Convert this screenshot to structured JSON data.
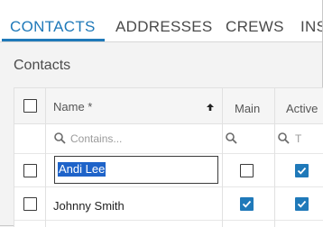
{
  "tabs": [
    {
      "label": "CONTACTS",
      "active": true
    },
    {
      "label": "ADDRESSES",
      "active": false
    },
    {
      "label": "CREWS",
      "active": false
    },
    {
      "label": "INS",
      "active": false
    }
  ],
  "section": {
    "title": "Contacts"
  },
  "grid": {
    "columns": {
      "name": "Name *",
      "main": "Main",
      "active": "Active"
    },
    "name_sort": "ascending",
    "filter": {
      "name_placeholder": "Contains...",
      "active_partial": "T"
    },
    "rows": [
      {
        "name": "Andi Lee",
        "selected": false,
        "main": false,
        "active": true,
        "editing": true
      },
      {
        "name": "Johnny Smith",
        "selected": false,
        "main": true,
        "active": true,
        "editing": false
      }
    ]
  },
  "colors": {
    "accent": "#1f79b9",
    "selection": "#1e63c9"
  },
  "icons": [
    "sort-up-icon",
    "search-icon",
    "checkmark-icon"
  ]
}
